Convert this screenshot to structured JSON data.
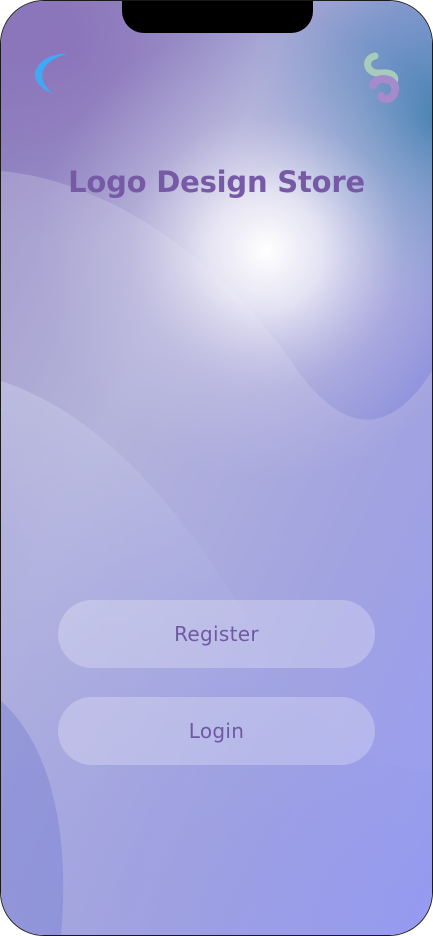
{
  "app": {
    "title": "Logo Design Store"
  },
  "top_left_icon": "crescent-logo-icon",
  "top_right_icon": "swirl-logo-icon",
  "buttons": {
    "register_label": "Register",
    "login_label": "Login"
  },
  "colors": {
    "title": "#765aa6",
    "button_text": "#6f5aa2",
    "background_top": "#8f80c0",
    "background_bottom": "#8088f6",
    "accent_blue": "#3fa9f5"
  }
}
